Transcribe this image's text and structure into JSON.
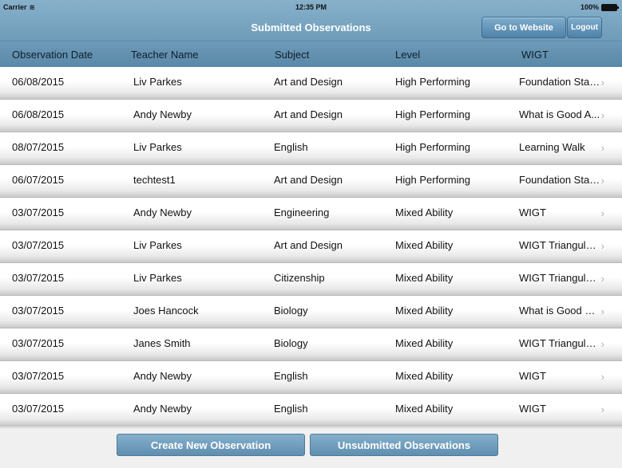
{
  "status_bar": {
    "carrier": "Carrier",
    "wifi_icon": "wifi-icon",
    "time": "12:35 PM",
    "battery": "100%",
    "battery_icon": "battery-icon"
  },
  "nav": {
    "title": "Submitted Observations",
    "go_to_website": "Go to Website",
    "logout": "Logout"
  },
  "columns": [
    "Observation Date",
    "Teacher Name",
    "Subject",
    "Level",
    "WIGT"
  ],
  "rows": [
    {
      "date": "06/08/2015",
      "teacher": "Liv Parkes",
      "subject": "Art and Design",
      "level": "High Performing",
      "wigt": "Foundation Stage"
    },
    {
      "date": "06/08/2015",
      "teacher": "Andy Newby",
      "subject": "Art and Design",
      "level": "High Performing",
      "wigt": "What is Good A..."
    },
    {
      "date": "08/07/2015",
      "teacher": "Liv Parkes",
      "subject": "English",
      "level": "High Performing",
      "wigt": "Learning Walk"
    },
    {
      "date": "06/07/2015",
      "teacher": "techtest1",
      "subject": "Art and Design",
      "level": "High Performing",
      "wigt": "Foundation Stage"
    },
    {
      "date": "03/07/2015",
      "teacher": "Andy Newby",
      "subject": "Engineering",
      "level": "Mixed Ability",
      "wigt": "WIGT"
    },
    {
      "date": "03/07/2015",
      "teacher": "Liv Parkes",
      "subject": "Art and Design",
      "level": "Mixed Ability",
      "wigt": "WIGT Triangulat..."
    },
    {
      "date": "03/07/2015",
      "teacher": "Liv Parkes",
      "subject": "Citizenship",
      "level": "Mixed Ability",
      "wigt": "WIGT Triangulat..."
    },
    {
      "date": "03/07/2015",
      "teacher": "Joes Hancock",
      "subject": "Biology",
      "level": "Mixed Ability",
      "wigt": "What is Good W..."
    },
    {
      "date": "03/07/2015",
      "teacher": "Janes Smith",
      "subject": "Biology",
      "level": "Mixed Ability",
      "wigt": "WIGT Triangulat..."
    },
    {
      "date": "03/07/2015",
      "teacher": "Andy Newby",
      "subject": "English",
      "level": "Mixed Ability",
      "wigt": "WIGT"
    },
    {
      "date": "03/07/2015",
      "teacher": "Andy Newby",
      "subject": "English",
      "level": "Mixed Ability",
      "wigt": "WIGT"
    }
  ],
  "row_icon": "chevron-right-icon",
  "toolbar": {
    "create_new": "Create New Observation",
    "unsubmitted": "Unsubmitted Observations"
  },
  "colors": {
    "nav_bar": "#7ba7c4",
    "header_bar": "#6592b1",
    "button": "#6f9cbd"
  }
}
